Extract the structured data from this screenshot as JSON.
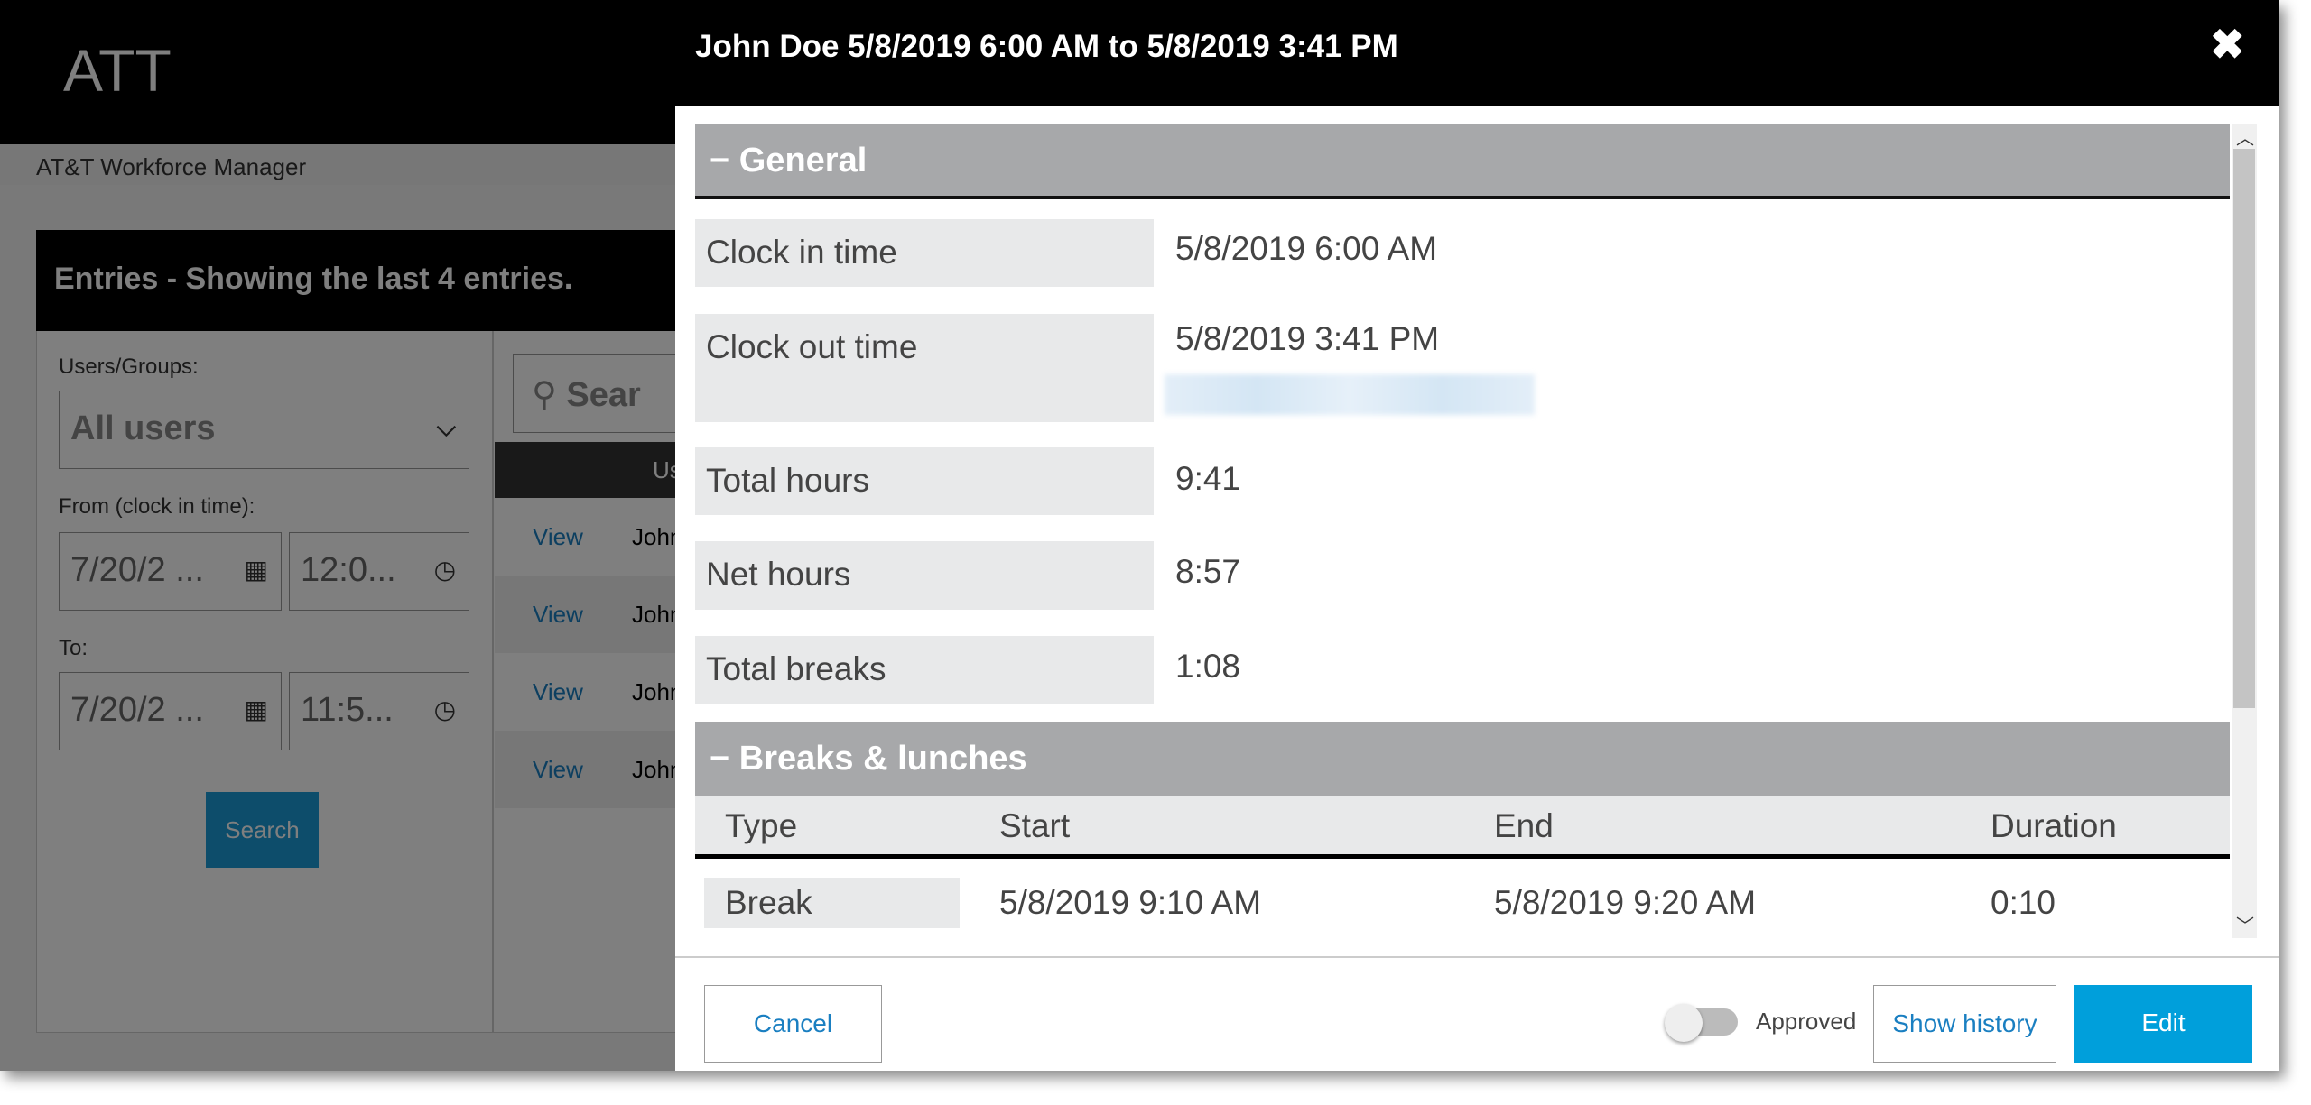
{
  "app": {
    "logo": "ATT",
    "subtitle": "AT&T Workforce Manager"
  },
  "entries": {
    "title": "Entries - Showing the last 4 entries.",
    "users_label": "Users/Groups:",
    "users_value": "All users",
    "from_label": "From (clock in time):",
    "from_date": "7/20/2 ...",
    "from_time": "12:0...",
    "to_label": "To:",
    "to_date": "7/20/2 ...",
    "to_time": "11:5...",
    "search_button": "Search",
    "search_placeholder": "Sear",
    "column_partial": "Us",
    "rows": [
      {
        "link": "View",
        "user": "John"
      },
      {
        "link": "View",
        "user": "John"
      },
      {
        "link": "View",
        "user": "John"
      },
      {
        "link": "View",
        "user": "John"
      }
    ]
  },
  "modal": {
    "title": "John Doe 5/8/2019 6:00 AM to 5/8/2019 3:41 PM",
    "general": {
      "title": "General",
      "fields": [
        {
          "label": "Clock in time",
          "value": "5/8/2019 6:00 AM"
        },
        {
          "label": "Clock out time",
          "value": "5/8/2019 3:41 PM"
        },
        {
          "label": "Total hours",
          "value": "9:41"
        },
        {
          "label": "Net hours",
          "value": "8:57"
        },
        {
          "label": "Total breaks",
          "value": "1:08"
        }
      ]
    },
    "breaks": {
      "title": "Breaks & lunches",
      "columns": [
        "Type",
        "Start",
        "End",
        "Duration"
      ],
      "rows": [
        {
          "type": "Break",
          "start": "5/8/2019 9:10 AM",
          "end": "5/8/2019 9:20 AM",
          "duration": "0:10"
        }
      ]
    },
    "footer": {
      "cancel": "Cancel",
      "approved_label": "Approved",
      "approved": false,
      "show_history": "Show history",
      "edit": "Edit"
    }
  },
  "colors": {
    "accent": "#009fdb",
    "section": "#a7a8aa",
    "link": "#1a7fc1"
  }
}
